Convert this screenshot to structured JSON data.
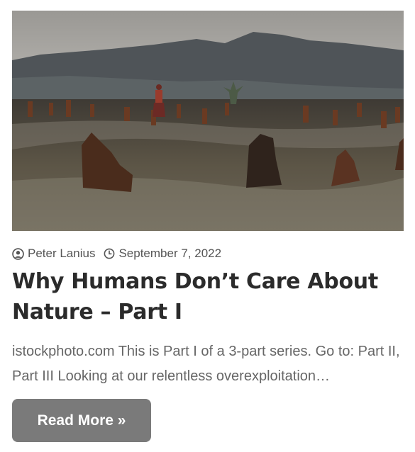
{
  "post": {
    "author": "Peter Lanius",
    "date": "September 7, 2022",
    "title": "Why Humans Don’t Care About Nature – Part I",
    "excerpt": "istockphoto.com This is Part I of a 3-part series. Go to: Part II, Part III Looking at our relentless overexploitation…",
    "read_more_label": "Read More »",
    "icons": {
      "author": "user-circle-icon",
      "date": "clock-icon"
    },
    "colors": {
      "button_bg": "#7a7a7a",
      "title": "#2b2b2b",
      "meta": "#555555",
      "excerpt": "#666666"
    }
  }
}
